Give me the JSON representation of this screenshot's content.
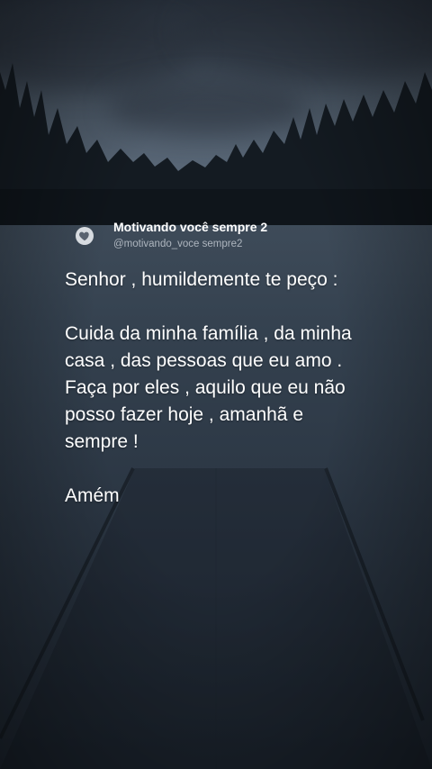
{
  "post": {
    "author_name": "Motivando você sempre 2",
    "author_handle": "@motivando_voce sempre2",
    "avatar_icon": "heart-icon",
    "paragraphs": [
      "Senhor , humildemente te peço :",
      "Cuida da minha família , da minha casa , das pessoas que eu amo . Faça por eles , aquilo que eu não posso fazer hoje , amanhã e sempre !",
      "Amém"
    ]
  },
  "colors": {
    "text": "#ffffff",
    "handle": "#aeb6bf",
    "background_dark": "#1c2530"
  }
}
